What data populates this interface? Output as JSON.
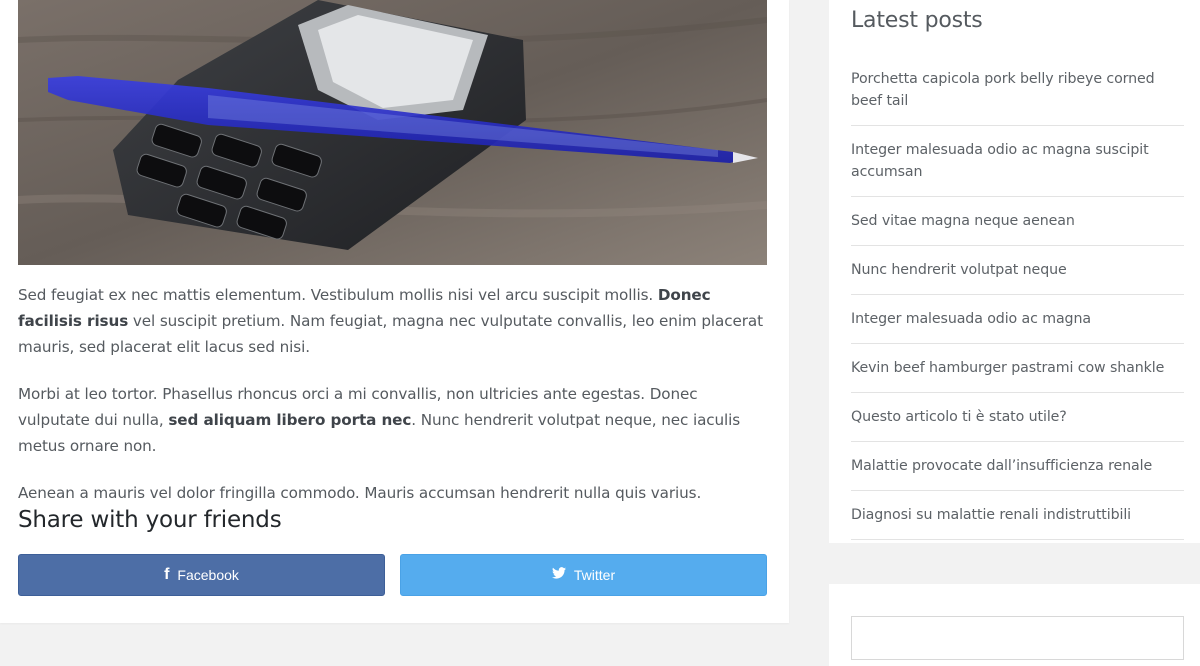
{
  "article": {
    "image_alt": "Mobile phone with a blue pen on a wooden desk",
    "paragraphs": [
      {
        "a": "Sed feugiat ex nec mattis elementum. Vestibulum mollis nisi vel arcu suscipit mollis. ",
        "b": "Donec facilisis risus",
        "c": " vel suscipit pretium. Nam feugiat, magna nec vulputate convallis, leo enim placerat mauris, sed placerat elit lacus sed nisi."
      },
      {
        "a": "Morbi at leo tortor. Phasellus rhoncus orci a mi convallis, non ultricies ante egestas. Donec vulputate dui nulla, ",
        "b": "sed aliquam libero porta nec",
        "c": ". Nunc hendrerit volutpat neque, nec iaculis metus ornare non."
      },
      {
        "a": "Aenean a mauris vel dolor fringilla commodo. Mauris accumsan hendrerit nulla quis varius."
      }
    ]
  },
  "share": {
    "title": "Share with your friends",
    "facebook_label": "Facebook",
    "facebook_icon": "f",
    "twitter_label": "Twitter",
    "facebook_color": "#4d6ea6",
    "twitter_color": "#55acee"
  },
  "sidebar": {
    "latest_title": "Latest posts",
    "posts": [
      "Porchetta capicola pork belly ribeye corned beef tail",
      "Integer malesuada odio ac magna suscipit accumsan",
      "Sed vitae magna neque aenean",
      "Nunc hendrerit volutpat neque",
      "Integer malesuada odio ac magna",
      "Kevin beef hamburger pastrami cow shankle",
      "Questo articolo ti è stato utile?",
      "Malattie provocate dall’insufficienza renale",
      "Diagnosi su malattie renali indistruttibili"
    ]
  }
}
